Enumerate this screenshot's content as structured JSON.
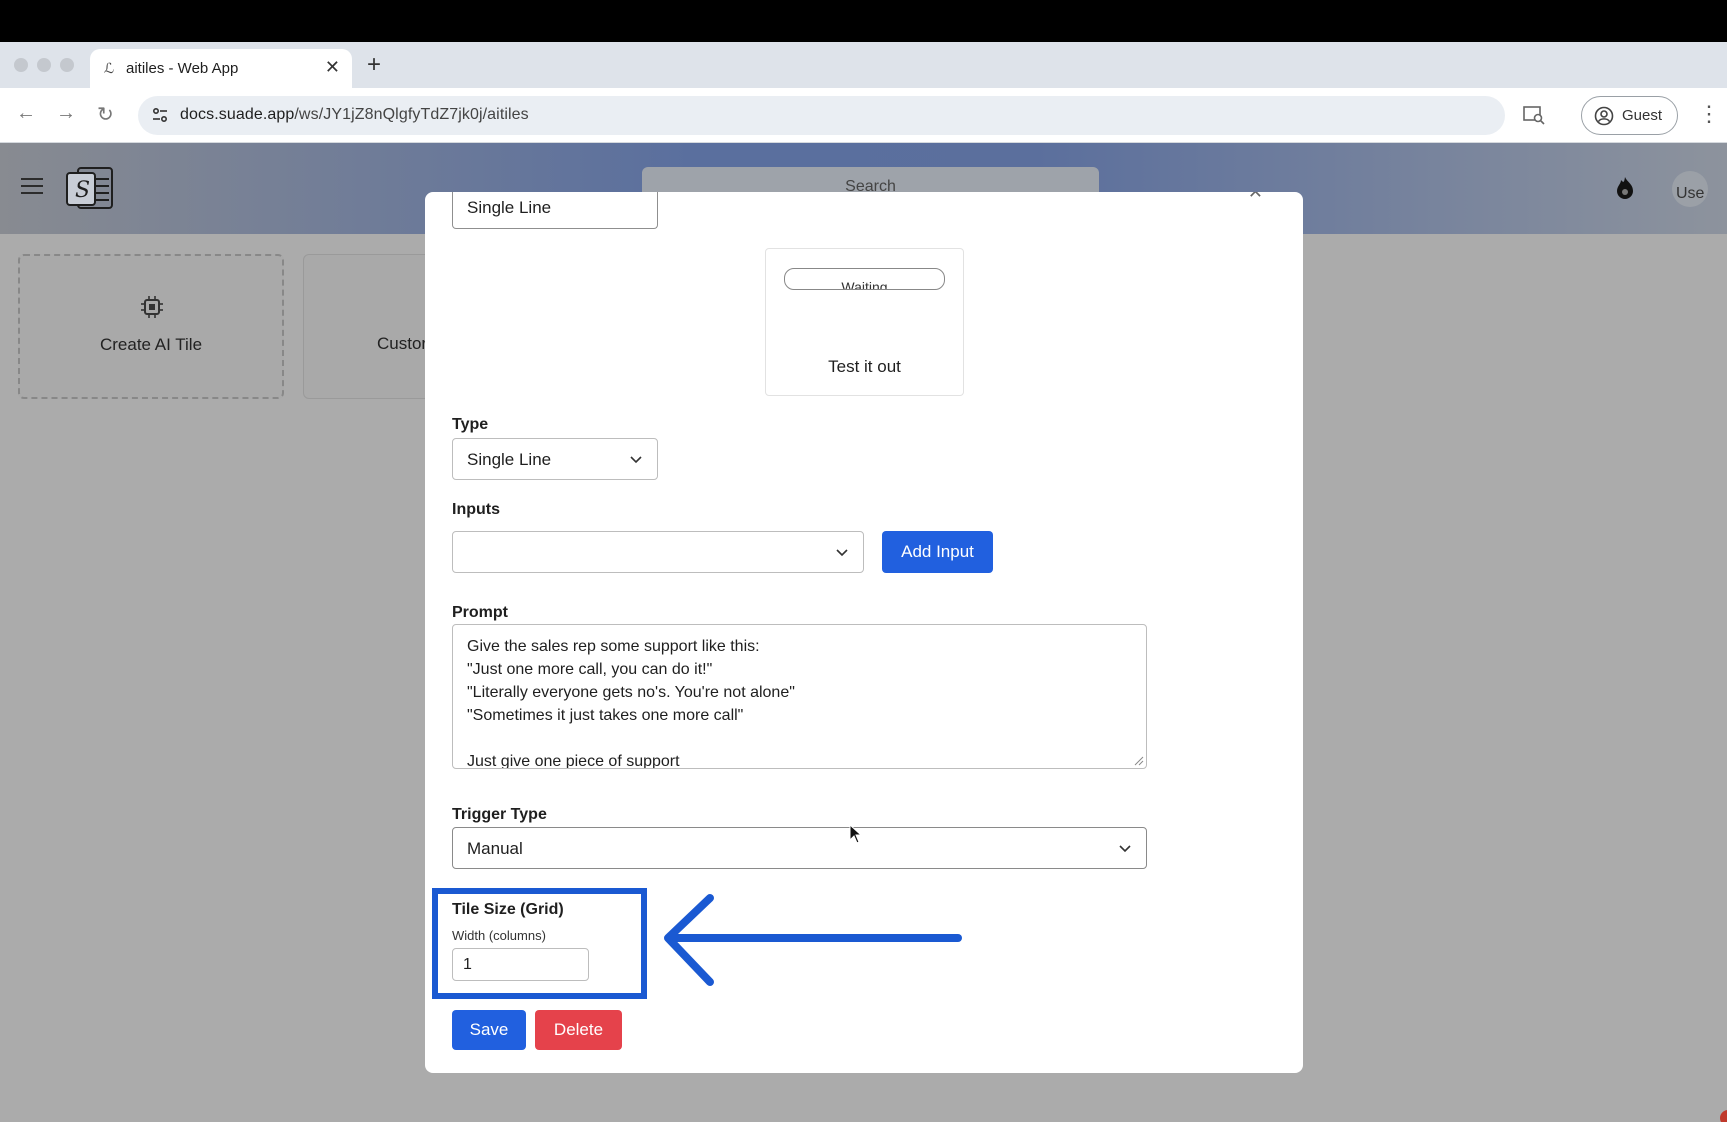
{
  "browser": {
    "tab_title": "aitiles - Web App",
    "url_host": "docs.suade.app",
    "url_path": "/ws/JY1jZ8nQlgfyTdZ7jk0j/aitiles",
    "profile_label": "Guest"
  },
  "app": {
    "search_placeholder": "Search",
    "avatar_alt": "Use",
    "cards": [
      {
        "label": "Create AI Tile",
        "icon": "chip-icon"
      },
      {
        "label": "Custor"
      }
    ]
  },
  "modal": {
    "top_field_value": "Single Line",
    "preview": {
      "status": "Waiting",
      "caption": "Test it out"
    },
    "type": {
      "label": "Type",
      "value": "Single Line"
    },
    "inputs": {
      "label": "Inputs",
      "value": "",
      "add_button": "Add Input"
    },
    "prompt": {
      "label": "Prompt",
      "lines": [
        "Give the sales rep some support like this:",
        "\"Just one more call, you can do it!\"",
        "\"Literally everyone gets no's. You're not alone\"",
        "\"Sometimes it just takes one more call\"",
        "",
        "Just give one piece of support"
      ]
    },
    "trigger": {
      "label": "Trigger Type",
      "value": "Manual"
    },
    "tile_size": {
      "label": "Tile Size (Grid)",
      "width_label": "Width (columns)",
      "width_value": "1"
    },
    "save_button": "Save",
    "delete_button": "Delete"
  },
  "colors": {
    "primary": "#2160df",
    "danger": "#e5424b",
    "annotation": "#1a59d2"
  }
}
